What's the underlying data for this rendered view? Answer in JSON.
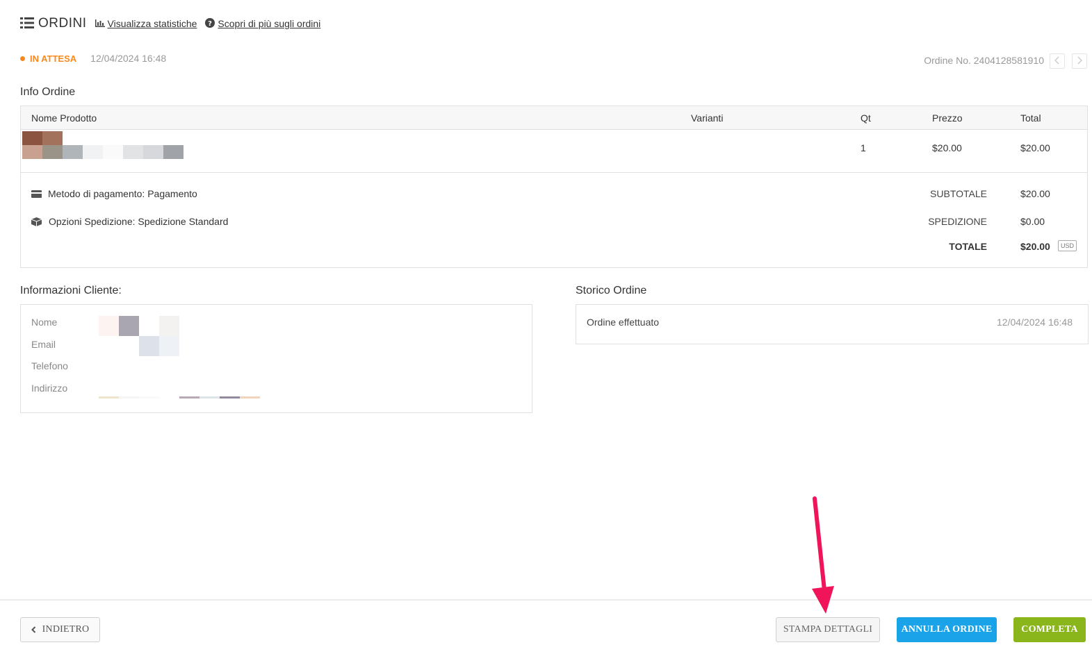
{
  "header": {
    "title": "ORDINI",
    "stats_link": "Visualizza statistiche",
    "learn_link": "Scopri di più sugli ordini"
  },
  "status": {
    "label": "IN ATTESA",
    "date": "12/04/2024 16:48",
    "order_number": "Ordine No. 2404128581910"
  },
  "order_info": {
    "title": "Info Ordine",
    "columns": [
      "Nome Prodotto",
      "Varianti",
      "Qt",
      "Prezzo",
      "Total"
    ],
    "rows": [
      {
        "qty": "1",
        "price": "$20.00",
        "total": "$20.00"
      }
    ],
    "payment": "Metodo di pagamento: Pagamento",
    "shipping": "Opzioni Spedizione: Spedizione Standard",
    "subtotal_label": "SUBTOTALE",
    "subtotal_value": "$20.00",
    "shipping_label": "SPEDIZIONE",
    "shipping_value": "$0.00",
    "total_label": "TOTALE",
    "total_value": "$20.00",
    "currency": "USD"
  },
  "client": {
    "title": "Informazioni Cliente:",
    "name_label": "Nome",
    "email_label": "Email",
    "phone_label": "Telefono",
    "address_label": "Indirizzo"
  },
  "history": {
    "title": "Storico Ordine",
    "event": "Ordine effettuato",
    "date": "12/04/2024 16:48"
  },
  "footer": {
    "back": "INDIETRO",
    "print": "STAMPA DETTAGLI",
    "cancel": "ANNULLA ORDINE",
    "complete": "COMPLETA"
  },
  "colors": {
    "status": "#f7891e",
    "cancel": "#1aa3e8",
    "complete": "#8ab61c",
    "arrow": "#f0145a"
  }
}
